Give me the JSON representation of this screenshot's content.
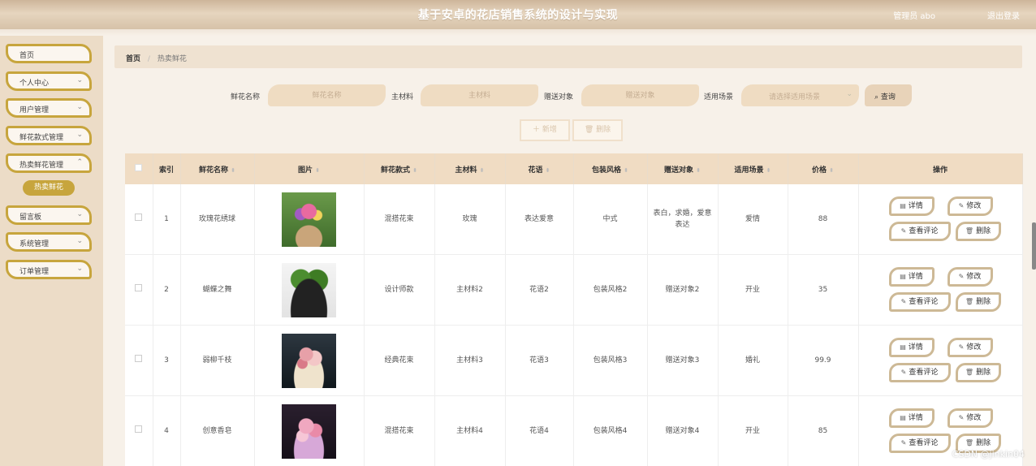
{
  "header": {
    "title": "基于安卓的花店销售系统的设计与实现",
    "user": "管理员 abo",
    "logout": "退出登录"
  },
  "sidebar": {
    "items": [
      {
        "label": "首页",
        "has_chevron": false
      },
      {
        "label": "个人中心",
        "has_chevron": true
      },
      {
        "label": "用户管理",
        "has_chevron": true
      },
      {
        "label": "鲜花款式管理",
        "has_chevron": true
      },
      {
        "label": "热卖鲜花管理",
        "has_chevron": true
      },
      {
        "label": "留言板",
        "has_chevron": true
      },
      {
        "label": "系统管理",
        "has_chevron": true
      },
      {
        "label": "订单管理",
        "has_chevron": true
      }
    ],
    "active_sub": "热卖鲜花"
  },
  "breadcrumb": {
    "home": "首页",
    "separator": "/",
    "current": "热卖鲜花"
  },
  "search": {
    "name_label": "鲜花名称",
    "name_placeholder": "鲜花名称",
    "material_label": "主材料",
    "material_placeholder": "主材料",
    "target_label": "赠送对象",
    "target_placeholder": "赠送对象",
    "scene_label": "适用场景",
    "scene_placeholder": "请选择适用场景",
    "query_button": "查询"
  },
  "actions": {
    "add": "新增",
    "delete": "删除"
  },
  "table": {
    "headers": {
      "index": "索引",
      "name": "鲜花名称",
      "image": "图片",
      "style": "鲜花款式",
      "material": "主材料",
      "language": "花语",
      "package": "包装风格",
      "target": "赠送对象",
      "scene": "适用场景",
      "price": "价格",
      "ops": "操作"
    },
    "rows": [
      {
        "index": "1",
        "name": "玫瑰花绣球",
        "image": "bouquet-red-purple",
        "style": "混搭花束",
        "material": "玫瑰",
        "language": "表达爱意",
        "package": "中式",
        "target": "表白，求婚，爱意表达",
        "scene": "爱情",
        "price": "88"
      },
      {
        "index": "2",
        "name": "蝴蝶之舞",
        "image": "potted-green-plant",
        "style": "设计师款",
        "material": "主材料2",
        "language": "花语2",
        "package": "包装风格2",
        "target": "赠送对象2",
        "scene": "开业",
        "price": "35"
      },
      {
        "index": "3",
        "name": "弱柳千枝",
        "image": "bouquet-pink-cream",
        "style": "经典花束",
        "material": "主材料3",
        "language": "花语3",
        "package": "包装风格3",
        "target": "赠送对象3",
        "scene": "婚礼",
        "price": "99.9"
      },
      {
        "index": "4",
        "name": "创意香皂",
        "image": "bouquet-pink-soap",
        "style": "混搭花束",
        "material": "主材料4",
        "language": "花语4",
        "package": "包装风格4",
        "target": "赠送对象4",
        "scene": "开业",
        "price": "85"
      }
    ],
    "op_labels": {
      "detail": "详情",
      "edit": "修改",
      "comments": "查看评论",
      "delete": "删除"
    }
  },
  "watermark": "CSDN @jinkin04"
}
